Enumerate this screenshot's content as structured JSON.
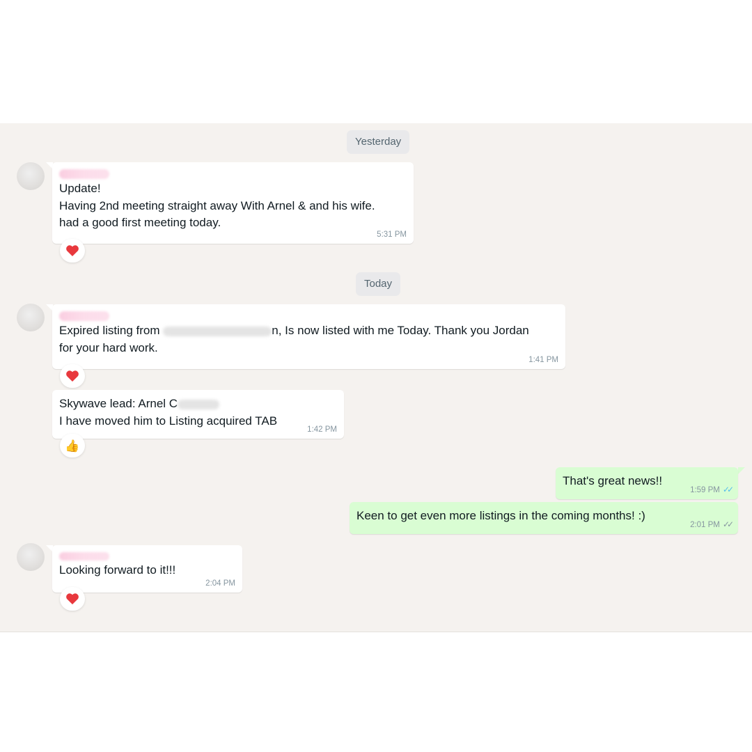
{
  "dates": {
    "yesterday": "Yesterday",
    "today": "Today"
  },
  "messages": [
    {
      "lines": [
        "Update!",
        "Having 2nd meeting straight away With Arnel & and his wife.",
        "had a good first meeting today."
      ],
      "time": "5:31 PM",
      "reaction": "❤️"
    },
    {
      "line1_a": "Expired listing from ",
      "line1_b": "n, Is now listed with me Today. Thank you Jordan",
      "line2": "for your hard work.",
      "time": "1:41 PM",
      "reaction": "❤️"
    },
    {
      "line1_a": "Skywave lead: Arnel C",
      "line2": "I have moved him to Listing acquired TAB",
      "time": "1:42 PM",
      "reaction": "👍"
    },
    {
      "text": "That's great news!!",
      "time": "1:59 PM",
      "ticks": "✓✓"
    },
    {
      "text": "Keen to get even more listings in the coming months!  :)",
      "time": "2:01 PM",
      "ticks": "✓✓"
    },
    {
      "text": "Looking forward to it!!!",
      "time": "2:04 PM",
      "reaction": "❤️"
    }
  ],
  "colors": {
    "chat_background": "#f5f2ef",
    "incoming_bubble": "#ffffff",
    "outgoing_bubble": "#d9fdd3",
    "read_ticks": "#53bdeb",
    "timestamp": "#8696a0"
  },
  "icons": {
    "avatar": "avatar-placeholder",
    "read_receipt": "double-check-icon",
    "heart": "heart-icon",
    "thumbs_up": "thumbs-up-icon"
  }
}
